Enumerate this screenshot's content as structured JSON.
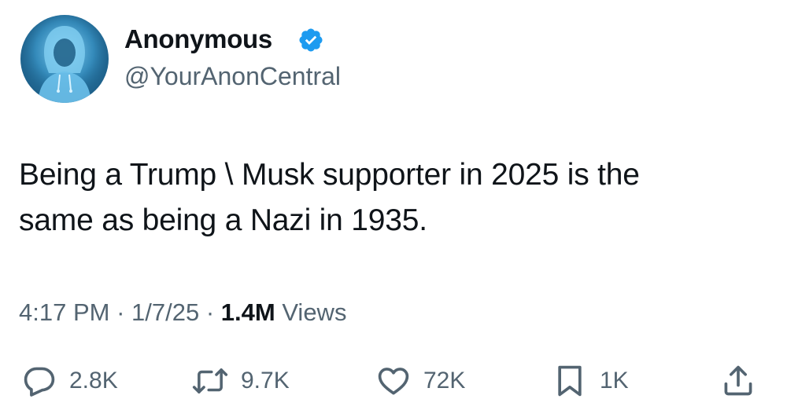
{
  "author": {
    "display_name": "Anonymous",
    "handle": "@YourAnonCentral",
    "verified": true,
    "verified_color": "#1d9bf0"
  },
  "tweet": {
    "text": "Being a Trump \\ Musk supporter in 2025 is the\nsame as being a Nazi in 1935."
  },
  "meta": {
    "time": "4:17 PM",
    "separator": " · ",
    "date": "1/7/25",
    "views_count": "1.4M",
    "views_label": " Views"
  },
  "actions": {
    "reply": {
      "icon": "reply-icon",
      "count": "2.8K"
    },
    "repost": {
      "icon": "repost-icon",
      "count": "9.7K"
    },
    "like": {
      "icon": "heart-icon",
      "count": "72K"
    },
    "bookmark": {
      "icon": "bookmark-icon",
      "count": "1K"
    },
    "share": {
      "icon": "share-icon"
    }
  },
  "colors": {
    "text_primary": "#0f1419",
    "text_secondary": "#536471",
    "background": "#ffffff"
  }
}
